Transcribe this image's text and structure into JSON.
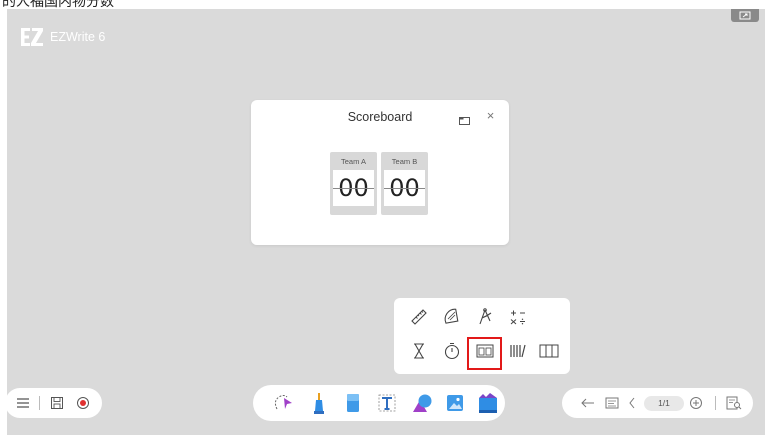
{
  "top_caption": "的人福国内物分数",
  "app": {
    "name": "EZWrite 6",
    "logo_text": "EZ"
  },
  "scoreboard": {
    "title": "Scoreboard",
    "team_a": {
      "name": "Team A",
      "score": "00"
    },
    "team_b": {
      "name": "Team B",
      "score": "00"
    }
  },
  "tools_panel": {
    "row1": [
      "ruler-icon",
      "protractor-icon",
      "compass-icon",
      "calculator-icon"
    ],
    "row2": [
      "hourglass-icon",
      "stopwatch-icon",
      "scoreboard-icon",
      "abacus-icon",
      "table-icon"
    ],
    "highlight": "scoreboard-icon"
  },
  "toolbar_left": [
    "menu-icon",
    "save-icon",
    "record-icon"
  ],
  "toolbar_center": [
    "select-icon",
    "pen-icon",
    "eraser-icon",
    "text-icon",
    "shape-icon",
    "image-icon",
    "tools-icon"
  ],
  "toolbar_right": {
    "page_indicator": "1/1"
  },
  "colors": {
    "canvas": "#dadada",
    "panel": "#ffffff",
    "highlight": "#e21919",
    "accent_blue": "#2f8de4"
  }
}
